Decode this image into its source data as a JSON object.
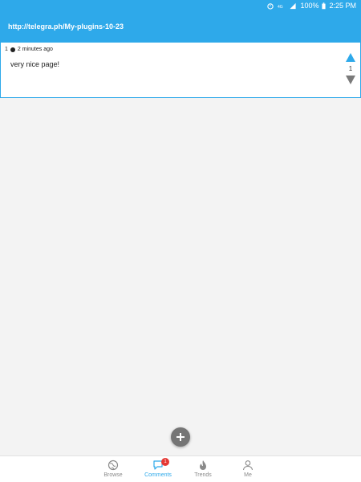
{
  "status_bar": {
    "battery": "100%",
    "time": "2:25 PM",
    "icons": [
      "alarm-icon",
      "network-icon",
      "signal-icon",
      "battery-icon"
    ]
  },
  "header": {
    "url": "http://telegra.ph/My-plugins-10-23"
  },
  "comment": {
    "number": "1",
    "time_ago": "2 minutes ago",
    "text": "very nice page!",
    "votes": "1"
  },
  "bottom_nav": {
    "items": [
      {
        "label": "Browse",
        "icon": "globe-icon"
      },
      {
        "label": "Comments",
        "icon": "comment-icon",
        "badge": "1"
      },
      {
        "label": "Trends",
        "icon": "flame-icon"
      },
      {
        "label": "Me",
        "icon": "user-icon"
      }
    ]
  },
  "colors": {
    "accent": "#2ea9ea",
    "fab": "#757575",
    "badge": "#e53935"
  }
}
